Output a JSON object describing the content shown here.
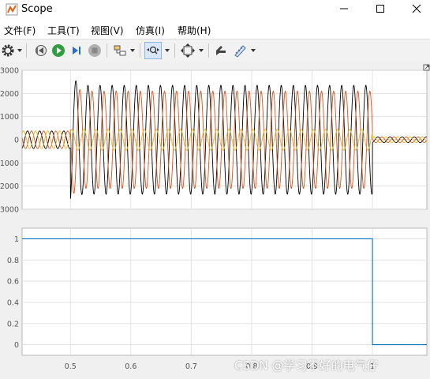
{
  "window": {
    "title": "Scope"
  },
  "menu": [
    "文件(F)",
    "工具(T)",
    "视图(V)",
    "仿真(I)",
    "帮助(H)"
  ],
  "colors": {
    "series_black": "#000000",
    "series_orange": "#d9541a",
    "series_yellow": "#edb120",
    "step_line": "#0072bd",
    "axes_bg": "#ffffff",
    "grid": "#dcdcdc"
  },
  "icons": [
    "scope-icon",
    "minimize-icon",
    "maximize-icon",
    "close-icon",
    "settings-gear-icon",
    "step-back-icon",
    "run-icon",
    "step-forward-icon",
    "stop-icon",
    "highlight-block-icon",
    "zoom-icon",
    "autoscale-icon",
    "cursor-measure-icon",
    "signal-stats-icon",
    "undock-icon"
  ],
  "chart_data": [
    {
      "type": "line",
      "ylim": [
        -3000,
        3000
      ],
      "yticks": [
        "3000",
        "2000",
        "1000",
        "0",
        "-1000",
        "-2000",
        "-3000"
      ],
      "xlim": [
        0.42,
        1.09
      ],
      "grid": true,
      "series": [
        {
          "color": "#000000",
          "segments": [
            {
              "x": [
                0.42,
                0.5
              ],
              "amplitude": 380
            },
            {
              "x": [
                0.5,
                1.0
              ],
              "amplitude": 2350,
              "peak": 2700
            },
            {
              "x": [
                1.0,
                1.09
              ],
              "amplitude": 120
            }
          ]
        },
        {
          "color": "#d9541a",
          "segments": [
            {
              "x": [
                0.42,
                0.5
              ],
              "amplitude": 380
            },
            {
              "x": [
                0.5,
                1.0
              ],
              "amplitude": 2100,
              "peak": 2400
            },
            {
              "x": [
                1.0,
                1.09
              ],
              "amplitude": 120
            }
          ]
        },
        {
          "color": "#edb120",
          "segments": [
            {
              "x": [
                0.42,
                0.5
              ],
              "amplitude": 380
            },
            {
              "x": [
                0.5,
                1.0
              ],
              "amplitude": 450
            },
            {
              "x": [
                1.0,
                1.09
              ],
              "amplitude": 120
            }
          ]
        }
      ]
    },
    {
      "type": "line",
      "ylim": [
        -0.1,
        1.1
      ],
      "yticks": [
        "1",
        "0.8",
        "0.6",
        "0.4",
        "0.2",
        "0"
      ],
      "xlim": [
        0.42,
        1.09
      ],
      "xticks": [
        "0.5",
        "0.6",
        "0.7",
        "0.8",
        "0.9",
        "1"
      ],
      "grid": true,
      "series": [
        {
          "color": "#0072bd",
          "x": [
            0.42,
            1.0,
            1.0,
            1.09
          ],
          "y": [
            1,
            1,
            0,
            0
          ]
        }
      ]
    }
  ],
  "watermark": "CSDN @学习不好的电气仔"
}
